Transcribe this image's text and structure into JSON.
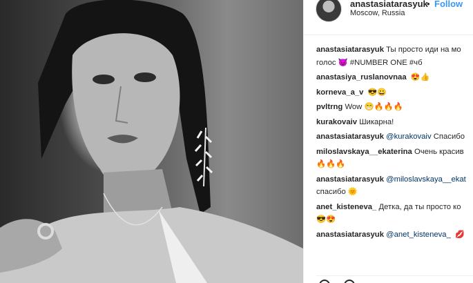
{
  "post": {
    "username": "anastasiatarasyuk",
    "dot": "•",
    "follow_label": "Follow",
    "location": "Moscow, Russia"
  },
  "comments": [
    {
      "user": "anastasiatarasyuk",
      "lines": [
        "Ты просто иди на мо",
        "голос 😈 #NUMBER ONE #чб"
      ],
      "mention": "",
      "tags": [
        "#NUMBER",
        "#чб"
      ]
    },
    {
      "user": "anastasiya_ruslanovnaa",
      "text": "😍👍"
    },
    {
      "user": "korneva_a_v",
      "text": "😎😀"
    },
    {
      "user": "pvltrng",
      "text": "Wow 😁🔥🔥🔥"
    },
    {
      "user": "kurakovaiv",
      "text": "Шикарна!"
    },
    {
      "user": "anastasiatarasyuk",
      "mention": "@kurakovaiv",
      "text": "Спасибо"
    },
    {
      "user": "miloslavskaya__ekaterina",
      "text": "Очень красив",
      "line2": "🔥🔥🔥"
    },
    {
      "user": "anastasiatarasyuk",
      "mention": "@miloslavskaya__ekat",
      "text": "",
      "line2": "спасибо 🌞"
    },
    {
      "user": "anet_kisteneva_",
      "text": "Детка, да ты просто ко",
      "line2": "😎😍"
    },
    {
      "user": "anastasiatarasyuk",
      "mention": "@anet_kisteneva_",
      "text": "💋"
    }
  ]
}
